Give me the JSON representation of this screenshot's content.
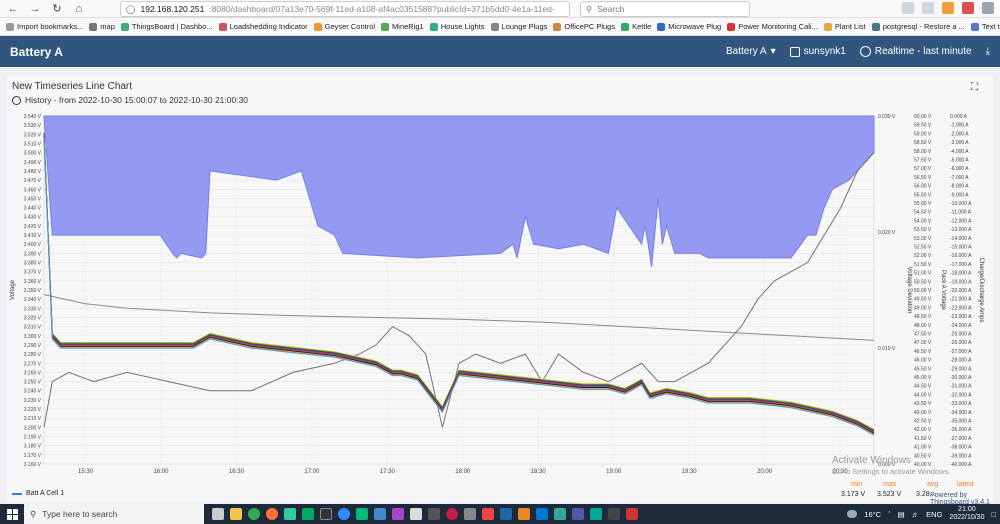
{
  "browser": {
    "url_host": "192.168.120.251",
    "url_path": ":8080/dashboard/07a13e70-569f-11ed-a108-af4ac0351588?publicId=371b5dd0-4e1a-11ed-",
    "search_placeholder": "Search"
  },
  "bookmarks": [
    "Import bookmarks...",
    "map",
    "ThingsBoard | Dashbo...",
    "Loadshedding Indicator",
    "Geyser Control",
    "MineRig1",
    "House Lights",
    "Lounge Plugs",
    "OfficePC Plugs",
    "Kettle",
    "Microwave Plug",
    "Power Monitoring Cali...",
    "Plant List",
    "postgresql - Restore a ...",
    "Text to ASCII Art Gene..."
  ],
  "header": {
    "title": "Battery A",
    "dashboard_state": "Battery A",
    "user": "sunsynk1",
    "timewindow": "Realtime - last minute"
  },
  "widget": {
    "title": "New Timeseries Line Chart",
    "history": "History - from 2022-10-30 15:00:07 to 2022-10-30 21:00:30"
  },
  "legend": {
    "label": "Batt A Cell 1",
    "min_label": "min",
    "max_label": "max",
    "avg_label": "avg",
    "latest_label": "latest",
    "min": "3.173 V",
    "max": "3.523 V",
    "avg": "3.28...",
    "latest": "...",
    "overlay_text": "Powered by Thingsboard v3.4.1"
  },
  "activate": {
    "line1": "Activate Windows",
    "line2": "Go to Settings to activate Windows."
  },
  "taskbar": {
    "search_placeholder": "Type here to search",
    "weather": "16°C",
    "lang": "ENG",
    "time": "21:00",
    "date": "2022/10/30"
  },
  "chart_data": {
    "type": "line",
    "x_ticks": [
      "15:30",
      "16:00",
      "16:30",
      "17:00",
      "17:30",
      "18:00",
      "18:30",
      "19:00",
      "19:30",
      "20:00",
      "20:30"
    ],
    "y_left_label": "Voltage",
    "y_left_ticks": [
      "3.540 V",
      "3.530 V",
      "3.520 V",
      "3.510 V",
      "3.500 V",
      "3.490 V",
      "3.480 V",
      "3.470 V",
      "3.460 V",
      "3.450 V",
      "3.440 V",
      "3.430 V",
      "3.420 V",
      "3.410 V",
      "3.400 V",
      "3.390 V",
      "3.380 V",
      "3.370 V",
      "3.360 V",
      "3.350 V",
      "3.340 V",
      "3.330 V",
      "3.320 V",
      "3.310 V",
      "3.300 V",
      "3.290 V",
      "3.280 V",
      "3.270 V",
      "3.260 V",
      "3.250 V",
      "3.240 V",
      "3.230 V",
      "3.220 V",
      "3.210 V",
      "3.200 V",
      "3.190 V",
      "3.180 V",
      "3.170 V",
      "3.160 V"
    ],
    "y_dev_label": "Voltage Deviation",
    "y_dev_ticks": [
      "0.030 V",
      "0.020 V",
      "0.010 V",
      "0.000 V"
    ],
    "y_pack_label": "Pack A Voltage",
    "y_pack_ticks": [
      "60.00 V",
      "59.50 V",
      "59.00 V",
      "58.50 V",
      "58.00 V",
      "57.50 V",
      "57.00 V",
      "56.50 V",
      "56.00 V",
      "55.50 V",
      "55.00 V",
      "54.50 V",
      "54.00 V",
      "53.50 V",
      "53.00 V",
      "52.50 V",
      "52.00 V",
      "51.50 V",
      "51.00 V",
      "50.50 V",
      "50.00 V",
      "49.50 V",
      "49.00 V",
      "48.50 V",
      "48.00 V",
      "47.50 V",
      "47.00 V",
      "46.50 V",
      "46.00 V",
      "45.50 V",
      "45.00 V",
      "44.50 V",
      "44.00 V",
      "43.50 V",
      "43.00 V",
      "42.50 V",
      "42.00 V",
      "41.50 V",
      "41.00 V",
      "40.50 V",
      "40.00 V"
    ],
    "y_amp_label": "Charge/Discharge Amps",
    "y_amp_ticks": [
      "0.000 A",
      "-1.000 A",
      "-2.000 A",
      "-3.000 A",
      "-4.000 A",
      "-5.000 A",
      "-6.000 A",
      "-7.000 A",
      "-8.000 A",
      "-9.000 A",
      "-10.000 A",
      "-11.000 A",
      "-12.000 A",
      "-13.000 A",
      "-14.000 A",
      "-15.000 A",
      "-16.000 A",
      "-17.000 A",
      "-18.000 A",
      "-19.000 A",
      "-20.000 A",
      "-21.000 A",
      "-22.000 A",
      "-23.000 A",
      "-24.000 A",
      "-25.000 A",
      "-26.000 A",
      "-27.000 A",
      "-28.000 A",
      "-29.000 A",
      "-30.000 A",
      "-31.000 A",
      "-32.000 A",
      "-33.000 A",
      "-34.000 A",
      "-35.000 A",
      "-36.000 A",
      "-37.000 A",
      "-38.000 A",
      "-39.000 A",
      "-40.000 A"
    ],
    "ylim_left": [
      3.16,
      3.54
    ],
    "x_range": [
      0,
      100
    ],
    "series": [
      {
        "color": "#6f77e8",
        "fill": "#8f96f2",
        "role": "deviation",
        "x": [
          0,
          0.3,
          1,
          2,
          4,
          10,
          14,
          15.5,
          16,
          16.5,
          19,
          19.5,
          20,
          28,
          31,
          33,
          35,
          35.5,
          36,
          45,
          55,
          56.5,
          57,
          58,
          59,
          62,
          65,
          68,
          69,
          72,
          72.4,
          72.8,
          73.2,
          74,
          74.5,
          75,
          76,
          79,
          80,
          85,
          90,
          92,
          93,
          94,
          95,
          97,
          98,
          100
        ],
        "y": [
          3.54,
          3.5,
          3.41,
          3.41,
          3.41,
          3.41,
          3.41,
          3.39,
          3.385,
          3.39,
          3.385,
          3.39,
          3.48,
          3.47,
          3.48,
          3.42,
          3.41,
          3.4,
          3.39,
          3.385,
          3.39,
          3.4,
          3.385,
          3.43,
          3.4,
          3.395,
          3.4,
          3.39,
          3.44,
          3.4,
          3.42,
          3.4,
          3.375,
          3.45,
          3.4,
          3.42,
          3.39,
          3.39,
          3.385,
          3.385,
          3.385,
          3.41,
          3.41,
          3.44,
          3.46,
          3.47,
          3.48,
          3.5
        ]
      },
      {
        "color": "#8a8a8a",
        "role": "pack",
        "x": [
          0,
          5,
          10,
          20,
          30,
          40,
          50,
          60,
          70,
          80,
          90,
          100
        ],
        "y": [
          3.345,
          3.335,
          3.33,
          3.325,
          3.322,
          3.32,
          3.318,
          3.315,
          3.31,
          3.305,
          3.3,
          3.295
        ]
      },
      {
        "color": "#7d6e6e",
        "role": "amps",
        "x": [
          0,
          1,
          3,
          6,
          10,
          15,
          20,
          25,
          30,
          35,
          38,
          40,
          42,
          44,
          46,
          48,
          50,
          52,
          55,
          58,
          60,
          62,
          65,
          68,
          70,
          72,
          74,
          76,
          78,
          80,
          82,
          84,
          86,
          88,
          90,
          92,
          94,
          96,
          98,
          100
        ],
        "y": [
          3.2,
          3.25,
          3.26,
          3.25,
          3.26,
          3.25,
          3.24,
          3.24,
          3.26,
          3.27,
          3.28,
          3.29,
          3.31,
          3.3,
          3.28,
          3.2,
          3.27,
          3.28,
          3.27,
          3.28,
          3.25,
          3.28,
          3.26,
          3.25,
          3.26,
          3.27,
          3.25,
          3.25,
          3.26,
          3.27,
          3.29,
          3.31,
          3.34,
          3.36,
          3.37,
          3.38,
          3.41,
          3.44,
          3.48,
          3.5
        ]
      },
      {
        "color": "#2e8b57",
        "role": "cells",
        "x": [
          0,
          1,
          2,
          5,
          10,
          15,
          18,
          20,
          25,
          30,
          35,
          40,
          42,
          43,
          45,
          48,
          50,
          55,
          60,
          65,
          68,
          70,
          72,
          73,
          75,
          78,
          80,
          85,
          90,
          95,
          98,
          100
        ],
        "y": [
          3.52,
          3.3,
          3.29,
          3.29,
          3.29,
          3.29,
          3.29,
          3.3,
          3.29,
          3.285,
          3.28,
          3.27,
          3.26,
          3.26,
          3.255,
          3.22,
          3.26,
          3.255,
          3.25,
          3.245,
          3.245,
          3.24,
          3.25,
          3.235,
          3.24,
          3.235,
          3.23,
          3.23,
          3.225,
          3.215,
          3.205,
          3.195
        ]
      }
    ]
  }
}
